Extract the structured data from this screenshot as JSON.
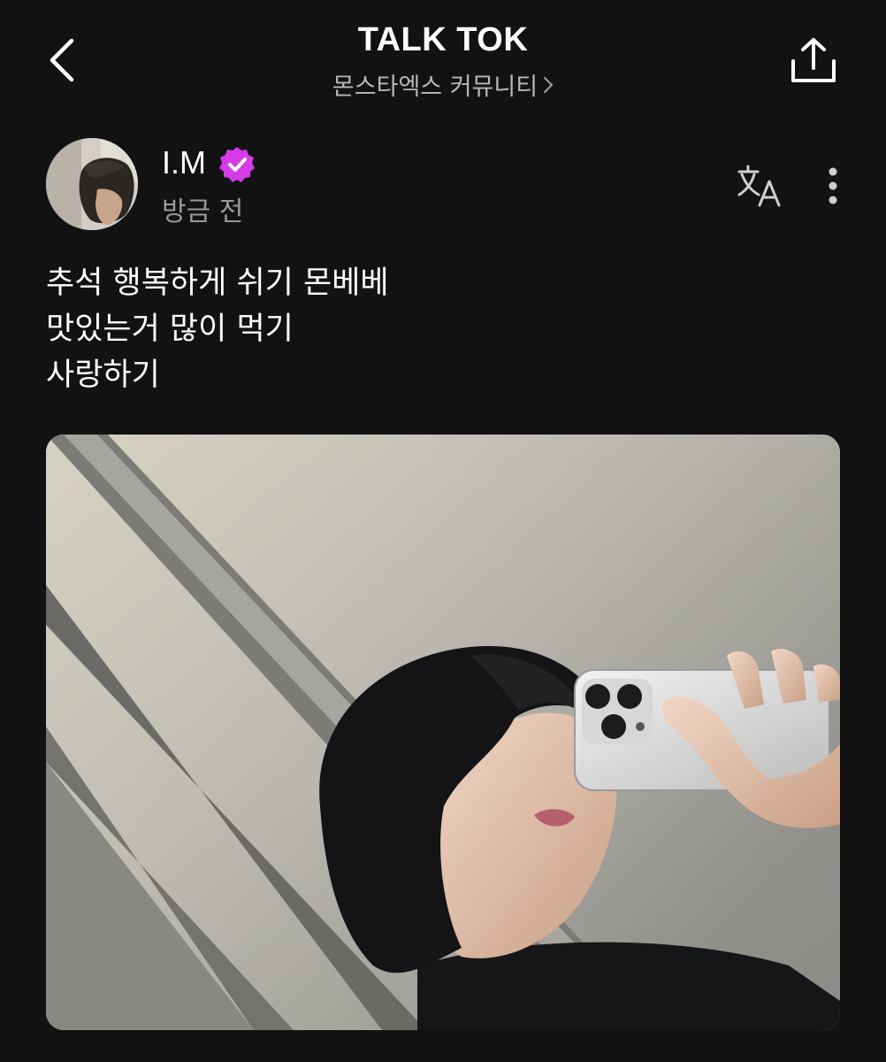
{
  "header": {
    "title": "TALK TOK",
    "community": "몬스타엑스 커뮤니티",
    "icons": {
      "back": "chevron-left-icon",
      "share": "share-icon",
      "community_chevron": "chevron-right-icon"
    }
  },
  "post": {
    "author": {
      "name": "I.M",
      "verified_icon": "verified-badge-icon",
      "verified_color": "#d63be8"
    },
    "time": "방금 전",
    "actions": {
      "translate_icon": "translate-icon",
      "more_icon": "more-vertical-icon"
    },
    "lines": [
      "추석 행복하게 쉬기 몬베베",
      "맛있는거 많이 먹기",
      "사랑하기"
    ]
  },
  "colors": {
    "background": "#121212",
    "text_primary": "#ffffff",
    "text_secondary": "#9a9a9a",
    "accent": "#d63be8"
  }
}
